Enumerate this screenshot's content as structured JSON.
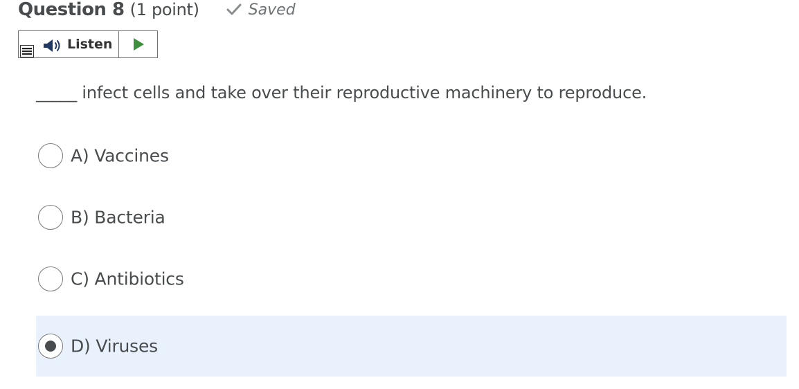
{
  "header": {
    "question_number": "Question 8",
    "points": "(1 point)",
    "saved_label": "Saved"
  },
  "listen": {
    "label": "Listen",
    "play_icon": "play-icon",
    "speaker_icon": "speaker-icon",
    "menu_icon": "menu-icon",
    "play_color": "#3d8f3d"
  },
  "question": {
    "text": "_____ infect cells and take over their reproductive machinery to reproduce."
  },
  "options": [
    {
      "label": "A) Vaccines",
      "selected": false
    },
    {
      "label": "B) Bacteria",
      "selected": false
    },
    {
      "label": "C) Antibiotics",
      "selected": false
    },
    {
      "label": "D) Viruses",
      "selected": true
    }
  ],
  "colors": {
    "selected_background": "#e8f1fc",
    "text": "#494c4e",
    "saved_text": "#6e7376"
  }
}
